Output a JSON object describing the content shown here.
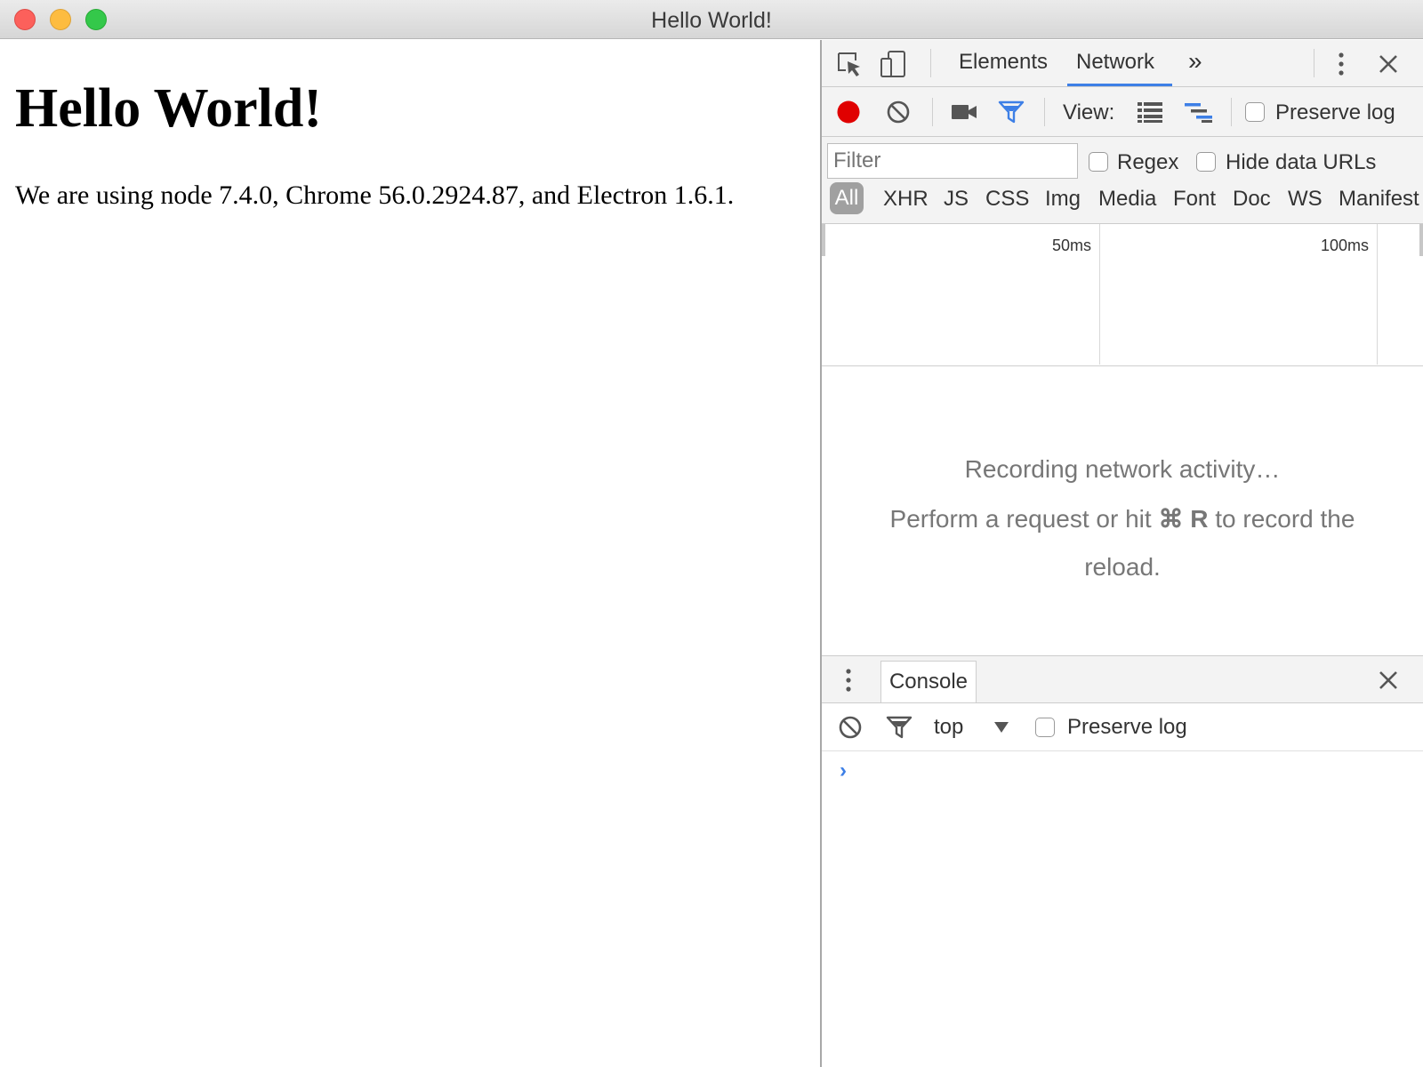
{
  "window": {
    "title": "Hello World!"
  },
  "page": {
    "heading": "Hello World!",
    "paragraph": "We are using node 7.4.0, Chrome 56.0.2924.87, and Electron 1.6.1."
  },
  "devtools": {
    "tabs": [
      {
        "label": "Elements",
        "active": false
      },
      {
        "label": "Network",
        "active": true
      }
    ],
    "more_tabs": "»",
    "network_toolbar": {
      "view_label": "View:",
      "preserve_log_label": "Preserve log",
      "recording": true
    },
    "filter_bar": {
      "filter_placeholder": "Filter",
      "regex_label": "Regex",
      "hide_data_urls_label": "Hide data URLs",
      "types": [
        "All",
        "XHR",
        "JS",
        "CSS",
        "Img",
        "Media",
        "Font",
        "Doc",
        "WS",
        "Manifest"
      ],
      "selected_type": "All"
    },
    "overview": {
      "ticks": [
        "50ms",
        "100ms"
      ]
    },
    "empty_state": {
      "line1": "Recording network activity…",
      "line2_prefix": "Perform a request or hit",
      "shortcut_symbol": "⌘",
      "shortcut_key": "R",
      "line2_suffix": "to record the",
      "line3": "reload."
    },
    "drawer": {
      "tab_label": "Console",
      "context": "top",
      "preserve_log_label": "Preserve log",
      "prompt": "›"
    }
  },
  "colors": {
    "record_active": "#e00000",
    "accent": "#3d7fe6"
  }
}
